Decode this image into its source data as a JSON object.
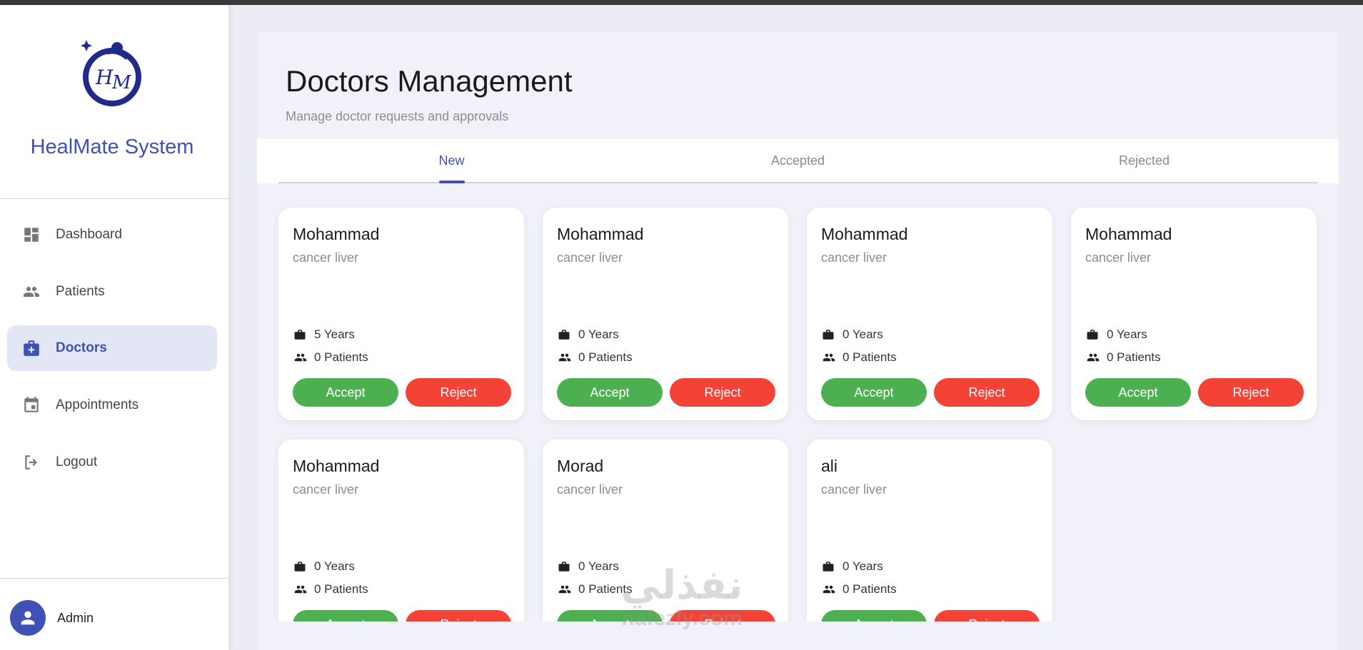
{
  "sidebar": {
    "brand": "HealMate System",
    "nav": [
      {
        "label": "Dashboard",
        "icon": "dashboard-icon",
        "active": false
      },
      {
        "label": "Patients",
        "icon": "people-icon",
        "active": false
      },
      {
        "label": "Doctors",
        "icon": "medical-bag-icon",
        "active": true
      },
      {
        "label": "Appointments",
        "icon": "calendar-icon",
        "active": false
      },
      {
        "label": "Logout",
        "icon": "logout-icon",
        "active": false
      }
    ],
    "user": {
      "name": "Admin",
      "icon": "person-icon"
    }
  },
  "header": {
    "title": "Doctors Management",
    "subtitle": "Manage doctor requests and approvals"
  },
  "tabs": [
    {
      "label": "New",
      "active": true
    },
    {
      "label": "Accepted",
      "active": false
    },
    {
      "label": "Rejected",
      "active": false
    }
  ],
  "buttons": {
    "accept": "Accept",
    "reject": "Reject"
  },
  "doctors": [
    {
      "name": "Mohammad",
      "specialty": "cancer liver",
      "experience": "5 Years",
      "patients": "0 Patients"
    },
    {
      "name": "Mohammad",
      "specialty": "cancer liver",
      "experience": "0 Years",
      "patients": "0 Patients"
    },
    {
      "name": "Mohammad",
      "specialty": "cancer liver",
      "experience": "0 Years",
      "patients": "0 Patients"
    },
    {
      "name": "Mohammad",
      "specialty": "cancer liver",
      "experience": "0 Years",
      "patients": "0 Patients"
    },
    {
      "name": "Mohammad",
      "specialty": "cancer liver",
      "experience": "0 Years",
      "patients": "0 Patients"
    },
    {
      "name": "Morad",
      "specialty": "cancer liver",
      "experience": "0 Years",
      "patients": "0 Patients"
    },
    {
      "name": "ali",
      "specialty": "cancer liver",
      "experience": "0 Years",
      "patients": "0 Patients"
    }
  ],
  "watermark": {
    "arabic": "نفذلي",
    "latin": "nafezly.com"
  },
  "colors": {
    "primary": "#3f51b5",
    "accept": "#4caf50",
    "reject": "#f44336"
  }
}
